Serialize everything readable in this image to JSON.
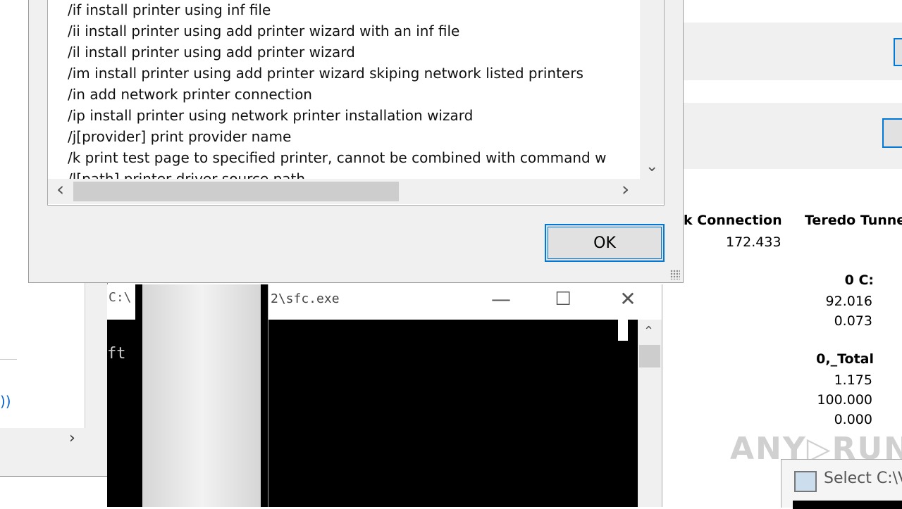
{
  "dialog": {
    "help_lines": [
      "/if install printer using inf file",
      "/ii install printer using add printer wizard with an inf file",
      "/il install printer using add printer wizard",
      "/im install printer using add printer wizard skiping network listed printers",
      "/in add network printer connection",
      "/ip install printer using network printer installation wizard",
      "/j[provider] print provider name",
      "/k print test page to specified printer, cannot be combined with command w",
      "/l[path] printer driver source path"
    ],
    "ok_label": "OK",
    "scroll_left_icon": "‹",
    "scroll_right_icon": "›",
    "scroll_down_icon": "⌄"
  },
  "sfc_window": {
    "title": "2\\sfc.exe",
    "minimize_icon": "—",
    "maximize_icon": "☐",
    "close_icon": "✕"
  },
  "console1": {
    "title_fragment": "C:\\",
    "text_fragment": "ft"
  },
  "perf": {
    "col1_header": "k Connection",
    "col2_header": "Teredo Tunne",
    "col1_value": "172.433",
    "disk_header": "0 C:",
    "disk_values": [
      "92.016",
      "0.073"
    ],
    "total_header": "0,_Total",
    "total_values": [
      "1.175",
      "100.000",
      "0.000"
    ]
  },
  "select_window": {
    "title": "Select C:\\V"
  },
  "watermark": "ANY▷RUN"
}
